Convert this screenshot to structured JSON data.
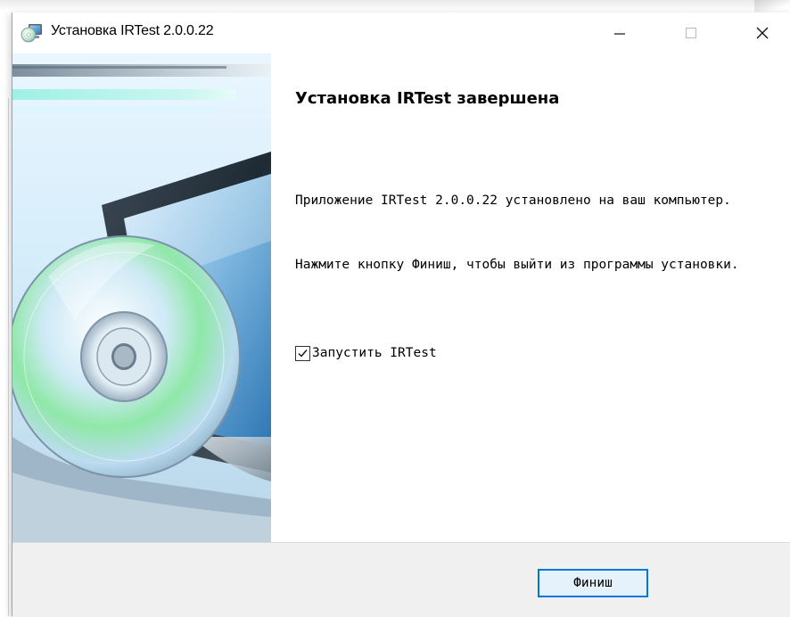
{
  "window": {
    "title": "Установка IRTest 2.0.0.22",
    "controls": {
      "minimize_icon": "minimize-icon",
      "maximize_icon": "maximize-icon",
      "close_icon": "close-icon"
    }
  },
  "page": {
    "heading": "Установка IRTest завершена",
    "paragraph_1": "Приложение IRTest 2.0.0.22 установлено на ваш компьютер.",
    "paragraph_2": "Нажмите кнопку Финиш, чтобы выйти из программы установки.",
    "launch_checkbox": {
      "label": "Запустить IRTest",
      "checked": true
    }
  },
  "footer": {
    "finish_label": "Финиш"
  },
  "colors": {
    "accent": "#0078d7",
    "button_bg": "#e5f1fb",
    "footer_bg": "#f0f0f0"
  }
}
